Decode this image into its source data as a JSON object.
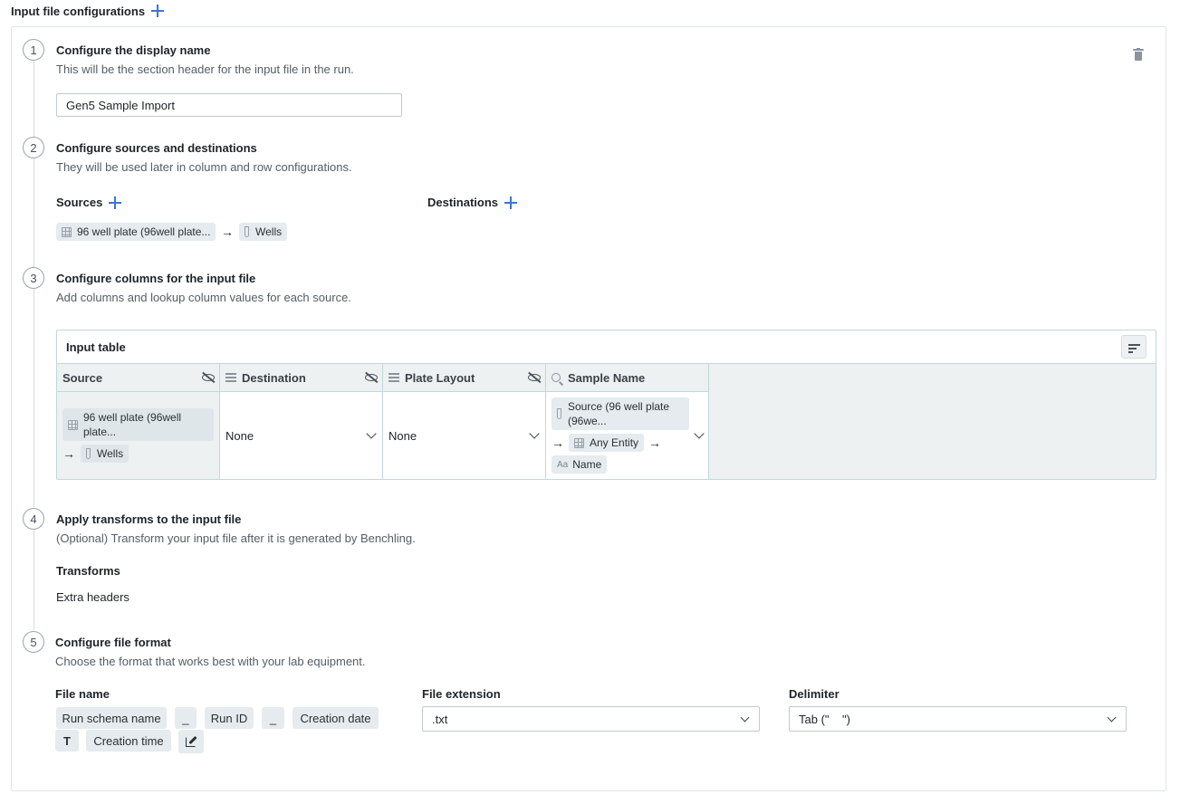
{
  "header": {
    "title": "Input file configurations"
  },
  "steps": [
    {
      "num": "1",
      "title": "Configure the display name",
      "desc": "This will be the section header for the input file in the run."
    },
    {
      "num": "2",
      "title": "Configure sources and destinations",
      "desc": "They will be used later in column and row configurations."
    },
    {
      "num": "3",
      "title": "Configure columns for the input file",
      "desc": "Add columns and lookup column values for each source."
    },
    {
      "num": "4",
      "title": "Apply transforms to the input file",
      "desc": "(Optional) Transform your input file after it is generated by Benchling."
    },
    {
      "num": "5",
      "title": "Configure file format",
      "desc": "Choose the format that works best with your lab equipment."
    }
  ],
  "display_name": {
    "value": "Gen5 Sample Import"
  },
  "sources": {
    "label": "Sources",
    "chip_plate": "96 well plate (96well plate...",
    "arrow": "→",
    "chip_wells": "Wells"
  },
  "destinations": {
    "label": "Destinations"
  },
  "input_table": {
    "title": "Input table",
    "columns": [
      {
        "label": "Source"
      },
      {
        "label": "Destination"
      },
      {
        "label": "Plate Layout"
      },
      {
        "label": "Sample Name"
      }
    ],
    "row": {
      "source_plate": "96 well plate (96well plate...",
      "source_arrow": "→",
      "source_wells": "Wells",
      "destination": "None",
      "plate_layout": "None",
      "sample_source": "Source (96 well plate (96we...",
      "sample_arrow1": "→",
      "sample_entity": "Any Entity",
      "sample_arrow2": "→",
      "sample_field": "Name",
      "sample_field_icon": "Aa"
    }
  },
  "transforms": {
    "label": "Transforms",
    "items": [
      "Extra headers"
    ]
  },
  "file_format": {
    "file_name_label": "File name",
    "parts": [
      "Run schema name",
      "_",
      "Run ID",
      "_",
      "Creation date",
      "T",
      "Creation time"
    ],
    "extension_label": "File extension",
    "extension_value": ".txt",
    "delimiter_label": "Delimiter",
    "delimiter_value": "Tab (\"    \")"
  },
  "colors": {
    "accent": "#3b74d6",
    "chip_bg": "#e5ebef",
    "table_border": "#c4d6d9",
    "table_header_bg": "#edf1f2"
  },
  "icons": {
    "add": "plus-icon",
    "delete": "trash-icon",
    "sort": "sort-lines-icon",
    "hide": "eye-off-icon",
    "list": "list-icon",
    "search": "search-icon",
    "plate": "plate-grid-icon",
    "well": "tube-icon",
    "edit": "edit-icon"
  }
}
